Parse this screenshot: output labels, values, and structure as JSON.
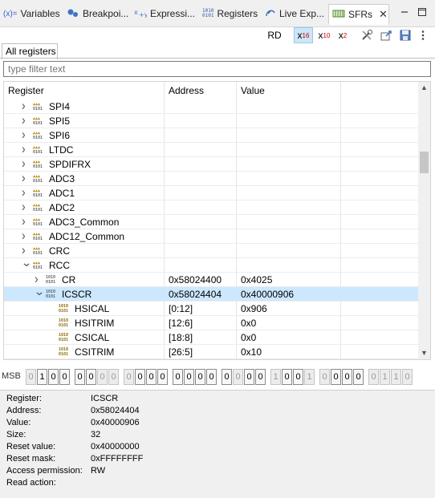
{
  "tabs": [
    {
      "label": "Variables",
      "icon": "variables-icon",
      "glyph": "(x)="
    },
    {
      "label": "Breakpoi...",
      "icon": "breakpoints-icon",
      "glyph": "●"
    },
    {
      "label": "Expressi...",
      "icon": "expressions-icon",
      "glyph": "x+y"
    },
    {
      "label": "Registers",
      "icon": "registers-icon",
      "glyph": "1010"
    },
    {
      "label": "Live Exp...",
      "icon": "live-expressions-icon",
      "glyph": "⟲"
    },
    {
      "label": "SFRs",
      "icon": "sfrs-icon",
      "glyph": "▦"
    }
  ],
  "toolbar": {
    "rd_label": "RD",
    "hex_label": "x",
    "hex_sub": "16",
    "dec_label": "x",
    "dec_sub": "10",
    "bin_label": "x",
    "bin_sub": "2"
  },
  "subtab": {
    "label": "All registers"
  },
  "filter": {
    "placeholder": "type filter text"
  },
  "table": {
    "headers": {
      "register": "Register",
      "address": "Address",
      "value": "Value"
    },
    "rows": [
      {
        "kind": "periph",
        "indent": 1,
        "twisty": ">",
        "name": "SPI4",
        "address": "",
        "value": ""
      },
      {
        "kind": "periph",
        "indent": 1,
        "twisty": ">",
        "name": "SPI5",
        "address": "",
        "value": ""
      },
      {
        "kind": "periph",
        "indent": 1,
        "twisty": ">",
        "name": "SPI6",
        "address": "",
        "value": ""
      },
      {
        "kind": "periph",
        "indent": 1,
        "twisty": ">",
        "name": "LTDC",
        "address": "",
        "value": ""
      },
      {
        "kind": "periph",
        "indent": 1,
        "twisty": ">",
        "name": "SPDIFRX",
        "address": "",
        "value": ""
      },
      {
        "kind": "periph",
        "indent": 1,
        "twisty": ">",
        "name": "ADC3",
        "address": "",
        "value": ""
      },
      {
        "kind": "periph",
        "indent": 1,
        "twisty": ">",
        "name": "ADC1",
        "address": "",
        "value": ""
      },
      {
        "kind": "periph",
        "indent": 1,
        "twisty": ">",
        "name": "ADC2",
        "address": "",
        "value": ""
      },
      {
        "kind": "periph",
        "indent": 1,
        "twisty": ">",
        "name": "ADC3_Common",
        "address": "",
        "value": ""
      },
      {
        "kind": "periph",
        "indent": 1,
        "twisty": ">",
        "name": "ADC12_Common",
        "address": "",
        "value": ""
      },
      {
        "kind": "periph",
        "indent": 1,
        "twisty": ">",
        "name": "CRC",
        "address": "",
        "value": ""
      },
      {
        "kind": "periph",
        "indent": 1,
        "twisty": "v",
        "name": "RCC",
        "address": "",
        "value": ""
      },
      {
        "kind": "reg",
        "indent": 2,
        "twisty": ">",
        "name": "CR",
        "address": "0x58024400",
        "value": "0x4025"
      },
      {
        "kind": "reg",
        "indent": 2,
        "twisty": "v",
        "name": "ICSCR",
        "address": "0x58024404",
        "value": "0x40000906",
        "selected": true
      },
      {
        "kind": "field",
        "indent": 3,
        "twisty": "",
        "name": "HSICAL",
        "address": "[0:12]",
        "value": "0x906"
      },
      {
        "kind": "field",
        "indent": 3,
        "twisty": "",
        "name": "HSITRIM",
        "address": "[12:6]",
        "value": "0x0"
      },
      {
        "kind": "field",
        "indent": 3,
        "twisty": "",
        "name": "CSICAL",
        "address": "[18:8]",
        "value": "0x0"
      },
      {
        "kind": "field",
        "indent": 3,
        "twisty": "",
        "name": "CSITRIM",
        "address": "[26:5]",
        "value": "0x10"
      }
    ]
  },
  "bits": {
    "msb_label": "MSB",
    "values": [
      "0",
      "1",
      "0",
      "0",
      "0",
      "0",
      "0",
      "0",
      "0",
      "0",
      "0",
      "0",
      "0",
      "0",
      "0",
      "0",
      "0",
      "0",
      "0",
      "0",
      "1",
      "0",
      "0",
      "1",
      "0",
      "0",
      "0",
      "0",
      "0",
      "1",
      "1",
      "0"
    ],
    "active": [
      false,
      true,
      true,
      true,
      true,
      true,
      false,
      false,
      false,
      true,
      true,
      true,
      true,
      true,
      true,
      true,
      true,
      false,
      true,
      true,
      false,
      true,
      true,
      false,
      false,
      true,
      true,
      true,
      false,
      false,
      false,
      false
    ]
  },
  "details": [
    {
      "label": "Register:",
      "value": "ICSCR"
    },
    {
      "label": "Address:",
      "value": "0x58024404"
    },
    {
      "label": "Value:",
      "value": "0x40000906"
    },
    {
      "label": "Size:",
      "value": "32"
    },
    {
      "label": "Reset value:",
      "value": "0x40000000"
    },
    {
      "label": "Reset mask:",
      "value": "0xFFFFFFFF"
    },
    {
      "label": "Access permission:",
      "value": "RW"
    },
    {
      "label": "Read action:",
      "value": ""
    }
  ]
}
